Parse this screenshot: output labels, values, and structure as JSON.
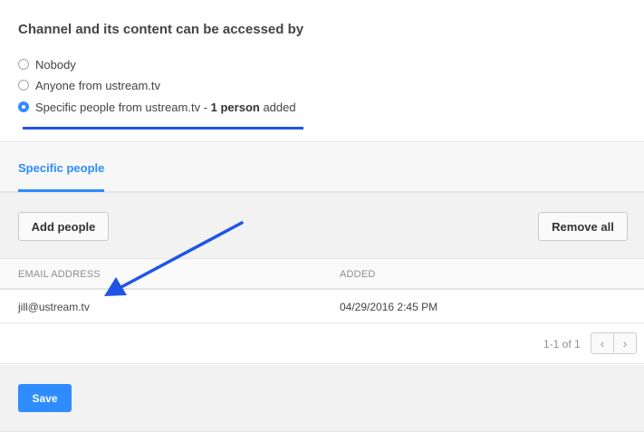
{
  "access": {
    "title": "Channel and its content can be accessed by",
    "options": [
      {
        "label": "Nobody",
        "checked": false
      },
      {
        "label": "Anyone from ustream.tv",
        "checked": false
      },
      {
        "label_prefix": "Specific people from ustream.tv - ",
        "label_bold": "1 person",
        "label_suffix": " added",
        "checked": true
      }
    ]
  },
  "tabs": [
    {
      "label": "Specific people",
      "active": true
    }
  ],
  "toolbar": {
    "add_label": "Add people",
    "remove_label": "Remove all"
  },
  "table": {
    "columns": [
      "EMAIL ADDRESS",
      "ADDED"
    ],
    "rows": [
      {
        "email": "jill@ustream.tv",
        "added": "04/29/2016 2:45 PM"
      }
    ]
  },
  "pagination": {
    "text": "1-1 of 1",
    "prev_icon": "‹",
    "next_icon": "›"
  },
  "footer": {
    "save_label": "Save"
  },
  "colors": {
    "accent": "#2f8cff",
    "annotation": "#1f55e6"
  }
}
